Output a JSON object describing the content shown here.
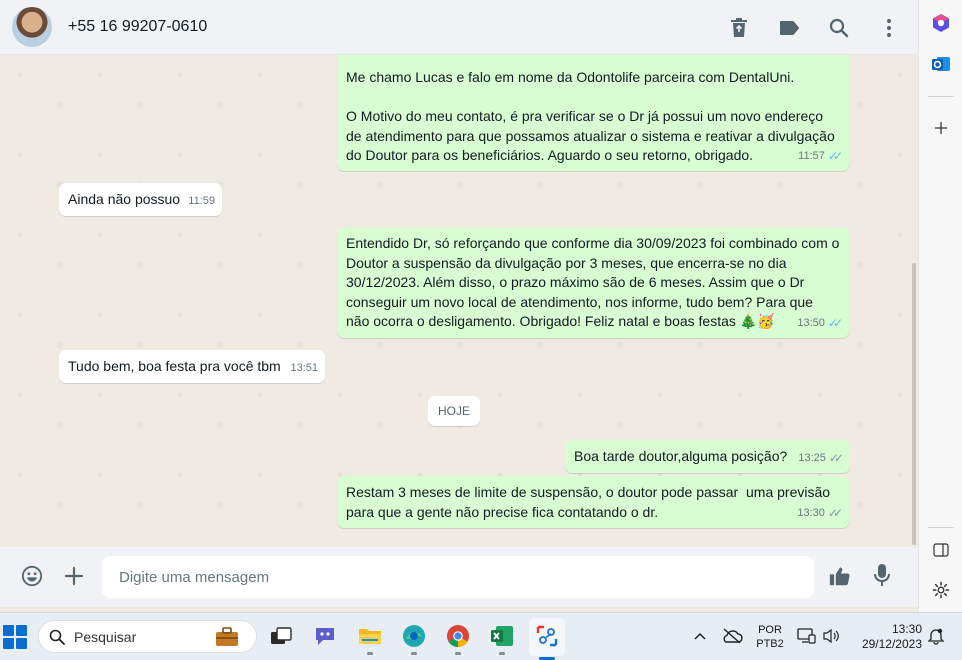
{
  "header": {
    "contact": "+55 16 99207-0610",
    "icons": [
      "delete-icon",
      "label-icon",
      "search-icon",
      "more-vertical-icon"
    ]
  },
  "messages": [
    {
      "direction": "out",
      "text": "Me chamo Lucas e falo em nome da Odontolife parceira com DentalUni.\n\nO Motivo do meu contato, é pra verificar se o Dr já possui um novo endereço de atendimento para que possamos atualizar o sistema e reativar a divulgação do Doutor para os beneficiários. Aguardo o seu retorno, obrigado.",
      "time": "11:57"
    },
    {
      "direction": "in",
      "text": "Ainda não possuo",
      "time": "11:59"
    },
    {
      "direction": "out",
      "text": "Entendido Dr, só reforçando que conforme dia 30/09/2023 foi combinado com o Doutor a suspensão da divulgação por 3 meses, que encerra-se no dia 30/12/2023. Além disso, o prazo máximo são de 6 meses. Assim que o Dr conseguir um novo local de atendimento, nos informe, tudo bem? Para que não ocorra o desligamento. Obrigado! Feliz natal e boas festas 🎄🥳",
      "time": "13:50"
    },
    {
      "direction": "in",
      "text": "Tudo bem, boa festa pra você tbm",
      "time": "13:51"
    },
    {
      "direction": "out",
      "text": "Boa tarde doutor,alguma posição?",
      "time": "13:25"
    },
    {
      "direction": "out",
      "text": "Restam 3 meses de limite de suspensão, o doutor pode passar  uma previsão para que a gente não precise fica contatando o dr.",
      "time": "13:30"
    }
  ],
  "day_separator": "HOJE",
  "composer": {
    "placeholder": "Digite uma mensagem"
  },
  "taskbar": {
    "search_label": "Pesquisar",
    "language": "POR",
    "layout": "PTB2",
    "time": "13:30",
    "date": "29/12/2023"
  },
  "colors": {
    "outgoing_bubble": "#d9fdd3",
    "incoming_bubble": "#ffffff",
    "chat_background": "#efeae2",
    "read_ticks": "#53bdeb"
  }
}
